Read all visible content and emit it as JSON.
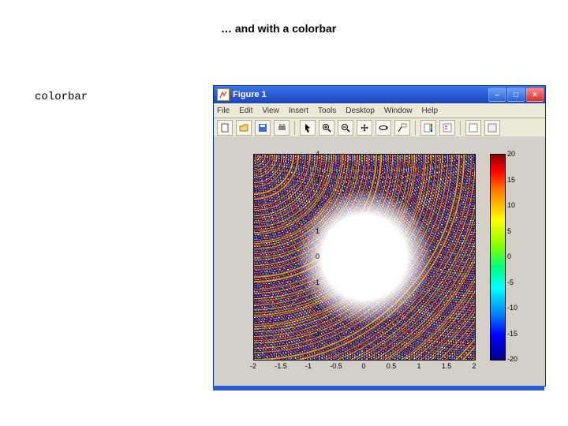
{
  "slide": {
    "title": "… and with a colorbar",
    "code": "colorbar"
  },
  "window": {
    "title": "Figure 1",
    "menus": [
      "File",
      "Edit",
      "View",
      "Insert",
      "Tools",
      "Desktop",
      "Window",
      "Help"
    ],
    "toolbar_icons": [
      "new-file-icon",
      "open-file-icon",
      "save-icon",
      "print-icon",
      "pointer-icon",
      "zoom-in-icon",
      "zoom-out-icon",
      "pan-icon",
      "rotate3d-icon",
      "data-cursor-icon",
      "insert-colorbar-icon",
      "insert-legend-icon",
      "link-plot-icon",
      "hide-tools-icon"
    ]
  },
  "chart_data": {
    "type": "contour",
    "title": "",
    "xlabel": "",
    "ylabel": "",
    "xlim": [
      -2,
      2
    ],
    "ylim": [
      -4,
      4
    ],
    "xticks": [
      -2,
      -1.5,
      -1,
      -0.5,
      0,
      0.5,
      1,
      1.5,
      2
    ],
    "yticks": [
      -3,
      -2,
      -1,
      0,
      1,
      2,
      3,
      4
    ],
    "colorbar": {
      "range": [
        -20,
        20
      ],
      "ticks": [
        -20,
        -15,
        -10,
        -5,
        0,
        5,
        10,
        15,
        20
      ],
      "colormap": "jet"
    },
    "note": "Contour of a saddle-like z(x,y); positive extremes (red) at top-left and bottom-right corners, negative extremes (blue) at top-right and bottom-left corners; central region near zero (sparse contours)."
  }
}
